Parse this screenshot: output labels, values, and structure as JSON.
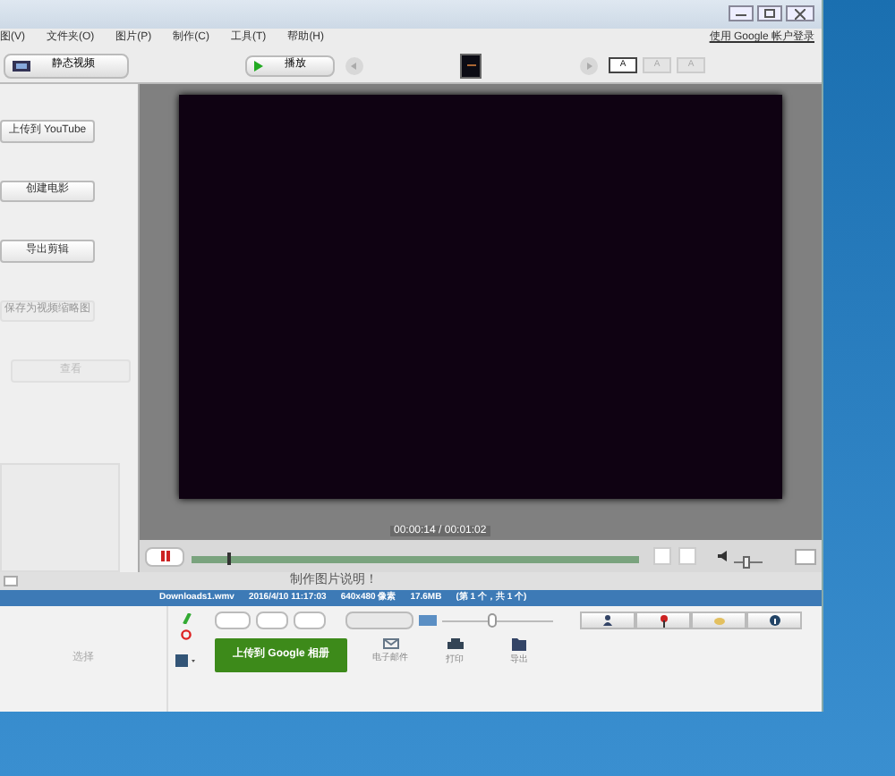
{
  "menu": [
    "图(V)",
    "文件夹(O)",
    "图片(P)",
    "制作(C)",
    "工具(T)",
    "帮助(H)"
  ],
  "sign_in": "使用 Google 帐户登录",
  "toolbar": {
    "still_button": "静态视频",
    "play_button": "播放"
  },
  "text_modes": [
    {
      "label": "A",
      "selected": true
    },
    {
      "label": "A",
      "selected": false
    },
    {
      "label": "A",
      "selected": false
    }
  ],
  "side_buttons": [
    {
      "label": "上传到 YouTube",
      "disabled": false
    },
    {
      "label": "创建电影",
      "disabled": false
    },
    {
      "label": "导出剪辑",
      "disabled": false
    },
    {
      "label": "保存为视频缩略图",
      "disabled": true
    }
  ],
  "view_button": "查看",
  "player": {
    "time": "00:00:14 / 00:01:02",
    "level": 0.08,
    "volume": {
      "level": 0.45
    },
    "caption": "制作图片说明！"
  },
  "status_bar": [
    "Downloads1.wmv",
    "2016/4/10 11:17:03",
    "640x480 像素",
    "17.6MB",
    "(第 1 个，共 1 个)"
  ],
  "tray": {
    "label": "选择"
  },
  "zoom": {
    "level": 0.45
  },
  "upload_button": "上传到 Google 相册",
  "actions": [
    {
      "kind": "email",
      "label": "电子邮件"
    },
    {
      "kind": "print",
      "label": "打印"
    },
    {
      "kind": "export",
      "label": "导出"
    }
  ]
}
